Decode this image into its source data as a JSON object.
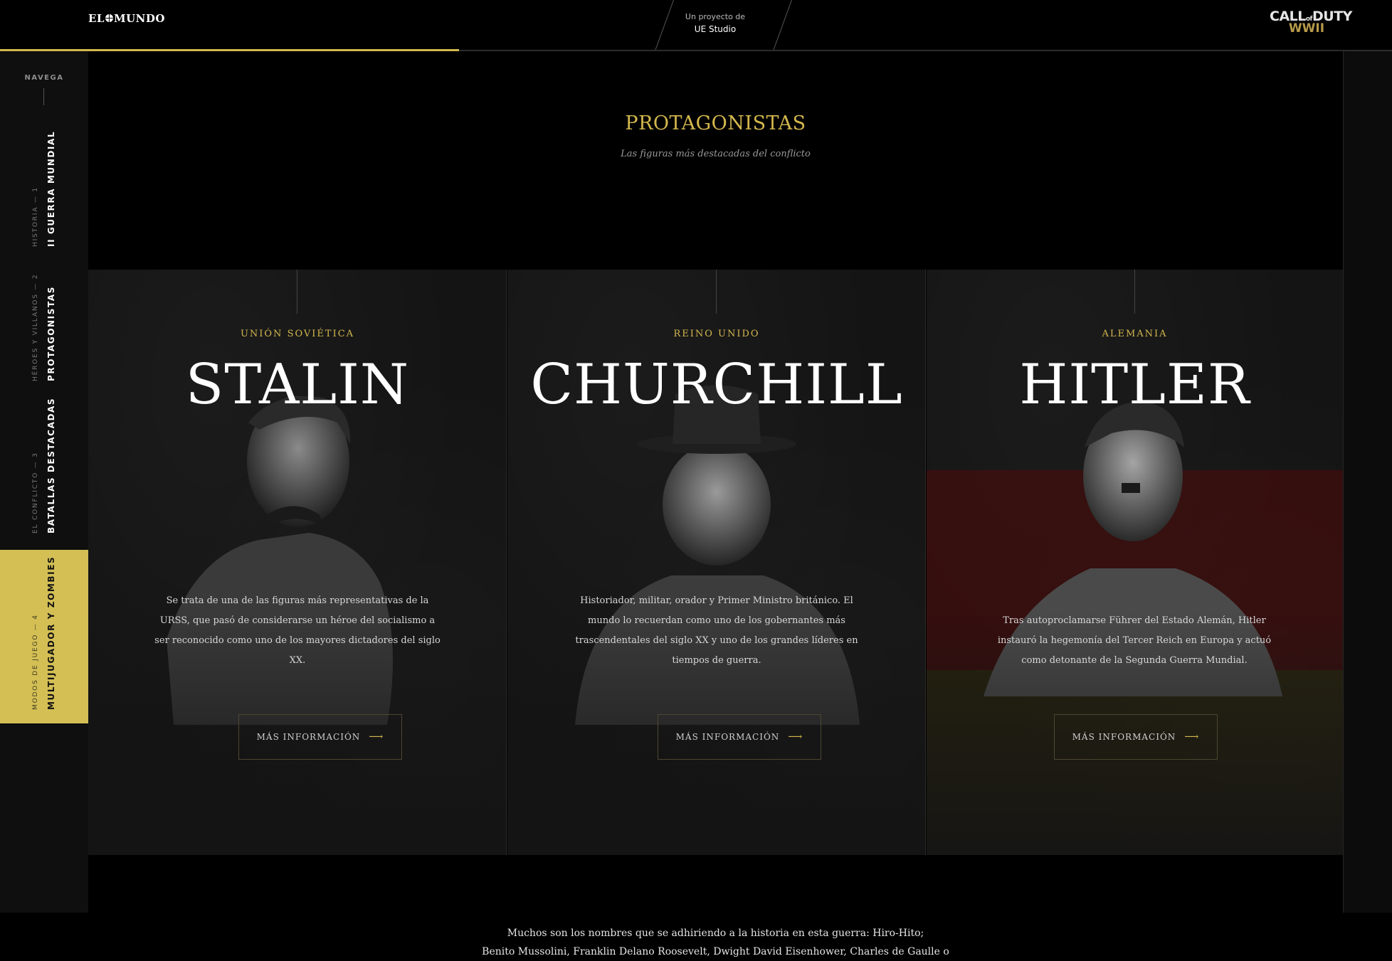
{
  "topbar": {
    "brand": "EL MUNDO",
    "project_line1": "Un proyecto de",
    "project_line2": "UE Studio",
    "sponsor_line1": "CALL DUTY",
    "sponsor_line2": "WWII",
    "progress_fraction": 0.33
  },
  "sidebar": {
    "title": "NAVEGA",
    "items": [
      {
        "sub": "HISTORIA — 1",
        "label": "II GUERRA MUNDIAL",
        "active": false
      },
      {
        "sub": "HÉROES Y VILLANOS — 2",
        "label": "PROTAGONISTAS",
        "active": false
      },
      {
        "sub": "EL CONFLICTO — 3",
        "label": "BATALLAS DESTACADAS",
        "active": false
      },
      {
        "sub": "MODOS DE JUEGO — 4",
        "label": "MULTIJUGADOR Y ZOMBIES",
        "active": true
      }
    ]
  },
  "section": {
    "title": "PROTAGONISTAS",
    "subtitle": "Las figuras más destacadas del conflicto"
  },
  "cards": [
    {
      "country": "UNIÓN SOVIÉTICA",
      "name": "STALIN",
      "desc": "Se trata de una de las figuras más representativas de la URSS, que pasó de considerarse un héroe del socialismo a ser reconocido como uno de los mayores dictadores del siglo XX.",
      "button": "MÁS INFORMACIÓN"
    },
    {
      "country": "REINO UNIDO",
      "name": "CHURCHILL",
      "desc": "Historiador, militar, orador y Primer Ministro británico. El mundo lo recuerdan como uno de los gobernantes más trascendentales del siglo XX y uno de los grandes líderes en tiempos de guerra.",
      "button": "MÁS INFORMACIÓN"
    },
    {
      "country": "ALEMANIA",
      "name": "HITLER",
      "desc": "Tras autoproclamarse Führer del Estado Alemán, Hitler instauró la hegemonía del Tercer Reich en Europa y actuó como detonante de la Segunda Guerra Mundial.",
      "button": "MÁS INFORMACIÓN"
    }
  ],
  "bottom": {
    "line1": "Muchos son los nombres que se adhiriendo a la historia en esta guerra: Hiro-Hito;",
    "line2": "Benito Mussolini, Franklin Delano Roosevelt, Dwight David Eisenhower, Charles de Gaulle o"
  },
  "colors": {
    "accent": "#d4b84e",
    "background": "#000000",
    "sidebar": "#0f0f0f",
    "active_nav": "#d4bf55"
  }
}
